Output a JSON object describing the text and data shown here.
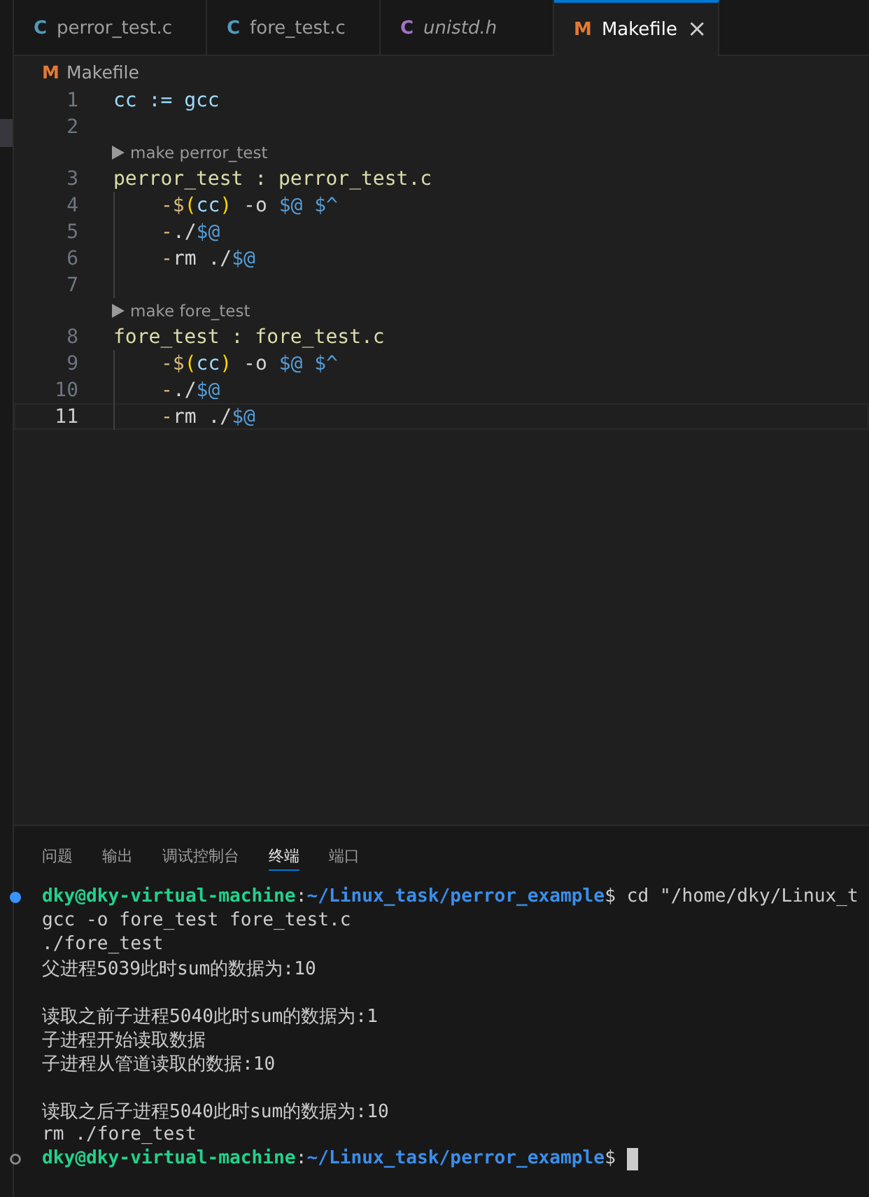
{
  "tabs": [
    {
      "icon": "C",
      "color": "#519aba",
      "label": "perror_test.c",
      "preview": false,
      "selected": false
    },
    {
      "icon": "C",
      "color": "#519aba",
      "label": "fore_test.c",
      "preview": false,
      "selected": false
    },
    {
      "icon": "C",
      "color": "#a074c4",
      "label": "unistd.h",
      "preview": true,
      "selected": false
    },
    {
      "icon": "M",
      "color": "#e37933",
      "label": "Makefile",
      "preview": false,
      "selected": true,
      "close": "×"
    }
  ],
  "breadcrumb": {
    "icon": "M",
    "label": "Makefile"
  },
  "editor": {
    "lines": [
      {
        "kind": "code",
        "number": "1",
        "current": false,
        "indent": false,
        "tokens": [
          {
            "kind": "variable",
            "text": "cc := gcc"
          }
        ]
      },
      {
        "kind": "code",
        "number": "2",
        "current": false,
        "indent": false
      },
      {
        "kind": "codelens",
        "text": "make perror_test"
      },
      {
        "kind": "code",
        "number": "3",
        "current": false,
        "indent": false,
        "tokens": [
          {
            "kind": "target",
            "text": "perror_test : perror_test.c"
          }
        ]
      },
      {
        "kind": "code",
        "number": "4",
        "current": false,
        "indent": true,
        "tokens": [
          {
            "kind": "operator",
            "text": "-$"
          },
          {
            "kind": "bracket",
            "text": "("
          },
          {
            "kind": "variable",
            "text": "cc"
          },
          {
            "kind": "bracket",
            "text": ")"
          },
          {
            "kind": "plain",
            "text": " -o "
          },
          {
            "kind": "automatic",
            "text": "$@ $^"
          }
        ]
      },
      {
        "kind": "code",
        "number": "5",
        "current": false,
        "indent": true,
        "tokens": [
          {
            "kind": "operator",
            "text": "-"
          },
          {
            "kind": "plain",
            "text": "./"
          },
          {
            "kind": "automatic",
            "text": "$@"
          }
        ]
      },
      {
        "kind": "code",
        "number": "6",
        "current": false,
        "indent": true,
        "tokens": [
          {
            "kind": "operator",
            "text": "-"
          },
          {
            "kind": "plain",
            "text": "rm ./"
          },
          {
            "kind": "automatic",
            "text": "$@"
          }
        ]
      },
      {
        "kind": "code",
        "number": "7",
        "current": false,
        "indent": true
      },
      {
        "kind": "codelens",
        "text": "make fore_test"
      },
      {
        "kind": "code",
        "number": "8",
        "current": false,
        "indent": false,
        "tokens": [
          {
            "kind": "target",
            "text": "fore_test : fore_test.c"
          }
        ]
      },
      {
        "kind": "code",
        "number": "9",
        "current": false,
        "indent": true,
        "tokens": [
          {
            "kind": "operator",
            "text": "-$"
          },
          {
            "kind": "bracket",
            "text": "("
          },
          {
            "kind": "variable",
            "text": "cc"
          },
          {
            "kind": "bracket",
            "text": ")"
          },
          {
            "kind": "plain",
            "text": " -o "
          },
          {
            "kind": "automatic",
            "text": "$@ $^"
          }
        ]
      },
      {
        "kind": "code",
        "number": "10",
        "current": false,
        "indent": true,
        "tokens": [
          {
            "kind": "operator",
            "text": "-"
          },
          {
            "kind": "plain",
            "text": "./"
          },
          {
            "kind": "automatic",
            "text": "$@"
          }
        ]
      },
      {
        "kind": "code",
        "number": "11",
        "current": true,
        "indent": true,
        "tokens": [
          {
            "kind": "operator",
            "text": "-"
          },
          {
            "kind": "plain",
            "text": "rm ./"
          },
          {
            "kind": "automatic",
            "text": "$@"
          }
        ]
      }
    ]
  },
  "panel": {
    "tabs": [
      {
        "label": "问题",
        "selected": false
      },
      {
        "label": "输出",
        "selected": false
      },
      {
        "label": "调试控制台",
        "selected": false
      },
      {
        "label": "终端",
        "selected": true
      },
      {
        "label": "端口",
        "selected": false
      }
    ],
    "terminal": [
      {
        "kind": "prompt",
        "success": true,
        "user": "dky@dky-virtual-machine",
        "separator": ":",
        "path": "~/Linux_task/perror_example",
        "sign": "$",
        "command": "cd \"/home/dky/Linux_t",
        "cursor": false
      },
      {
        "kind": "output",
        "text": "gcc -o fore_test fore_test.c"
      },
      {
        "kind": "output",
        "text": "./fore_test"
      },
      {
        "kind": "output",
        "text": "父进程5039此时sum的数据为:10"
      },
      {
        "kind": "blank"
      },
      {
        "kind": "output",
        "text": "读取之前子进程5040此时sum的数据为:1"
      },
      {
        "kind": "output",
        "text": "子进程开始读取数据"
      },
      {
        "kind": "output",
        "text": "子进程从管道读取的数据:10"
      },
      {
        "kind": "blank"
      },
      {
        "kind": "output",
        "text": "读取之后子进程5040此时sum的数据为:10"
      },
      {
        "kind": "output",
        "text": "rm ./fore_test"
      },
      {
        "kind": "prompt",
        "success": false,
        "user": "dky@dky-virtual-machine",
        "separator": ":",
        "path": "~/Linux_task/perror_example",
        "sign": "$",
        "cursor": true
      }
    ]
  }
}
